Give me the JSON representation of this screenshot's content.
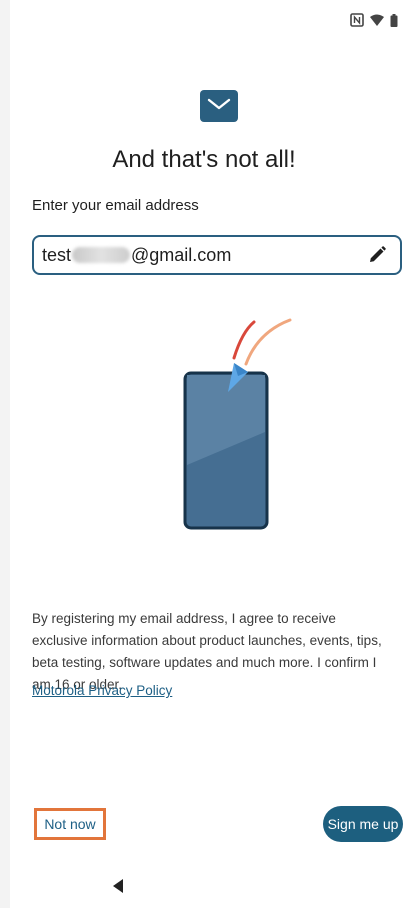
{
  "status_bar": {
    "icons": [
      "nfc-icon",
      "wifi-icon",
      "battery-icon"
    ]
  },
  "header": {
    "icon": "mail-icon",
    "title": "And that's not all!"
  },
  "form": {
    "email_label": "Enter your email address",
    "email_prefix": "test",
    "email_suffix": "@gmail.com",
    "edit_icon": "pencil-icon"
  },
  "consent": {
    "text": "By registering my email address, I agree to receive exclusive information about product launches, events, tips, beta testing, software updates and much more. I confirm I am 16 or older.",
    "privacy_link": "Motorola Privacy Policy"
  },
  "actions": {
    "not_now_label": "Not now",
    "sign_up_label": "Sign me up"
  },
  "colors": {
    "accent": "#1d5f7f",
    "highlight": "#e2753b"
  }
}
